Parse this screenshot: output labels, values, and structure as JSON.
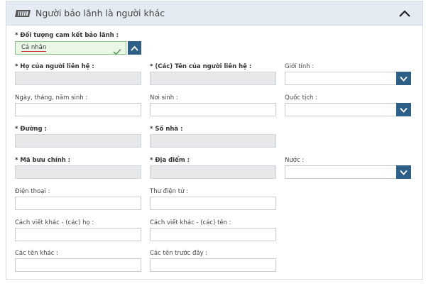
{
  "panel": {
    "title": "Người bảo lãnh là người khác",
    "icon": "ticket-icon",
    "toggle_icon": "chevron-up-icon"
  },
  "form": {
    "commitment_subject": {
      "label": "* Đối tượng cam kết bảo lãnh :",
      "value": "Cá nhân"
    },
    "last_name": {
      "label": "* Họ của người liên hệ :",
      "value": ""
    },
    "first_name": {
      "label": "* (Các) Tên của người liên hệ :",
      "value": ""
    },
    "gender": {
      "label": "Giới tính :",
      "value": ""
    },
    "birth_date": {
      "label": "Ngày, tháng, năm sinh :",
      "value": ""
    },
    "birth_place": {
      "label": "Nơi sinh :",
      "value": ""
    },
    "nationality": {
      "label": "Quốc tịch :",
      "value": ""
    },
    "street": {
      "label": "* Đường :",
      "value": ""
    },
    "house_number": {
      "label": "* Số nhà :",
      "value": ""
    },
    "postal_code": {
      "label": "* Mã bưu chính :",
      "value": ""
    },
    "locality": {
      "label": "* Địa điểm :",
      "value": ""
    },
    "country": {
      "label": "Nước :",
      "value": ""
    },
    "phone": {
      "label": "Điện thoại :",
      "value": ""
    },
    "email": {
      "label": "Thư điện tử :",
      "value": ""
    },
    "alt_last_names": {
      "label": "Cách viết khác - (các) họ :",
      "value": ""
    },
    "alt_first_names": {
      "label": "Cách viết khác - (các) tên :",
      "value": ""
    },
    "other_names": {
      "label": "Các tên khác :",
      "value": ""
    },
    "previous_names": {
      "label": "Các tên trước đây :",
      "value": ""
    }
  },
  "colors": {
    "header_bg": "#e4ebf2",
    "accent": "#2e5f86",
    "valid_bg": "#eaf6e6",
    "valid_border": "#8cc08a",
    "disabled_bg": "#e6e8ea"
  }
}
